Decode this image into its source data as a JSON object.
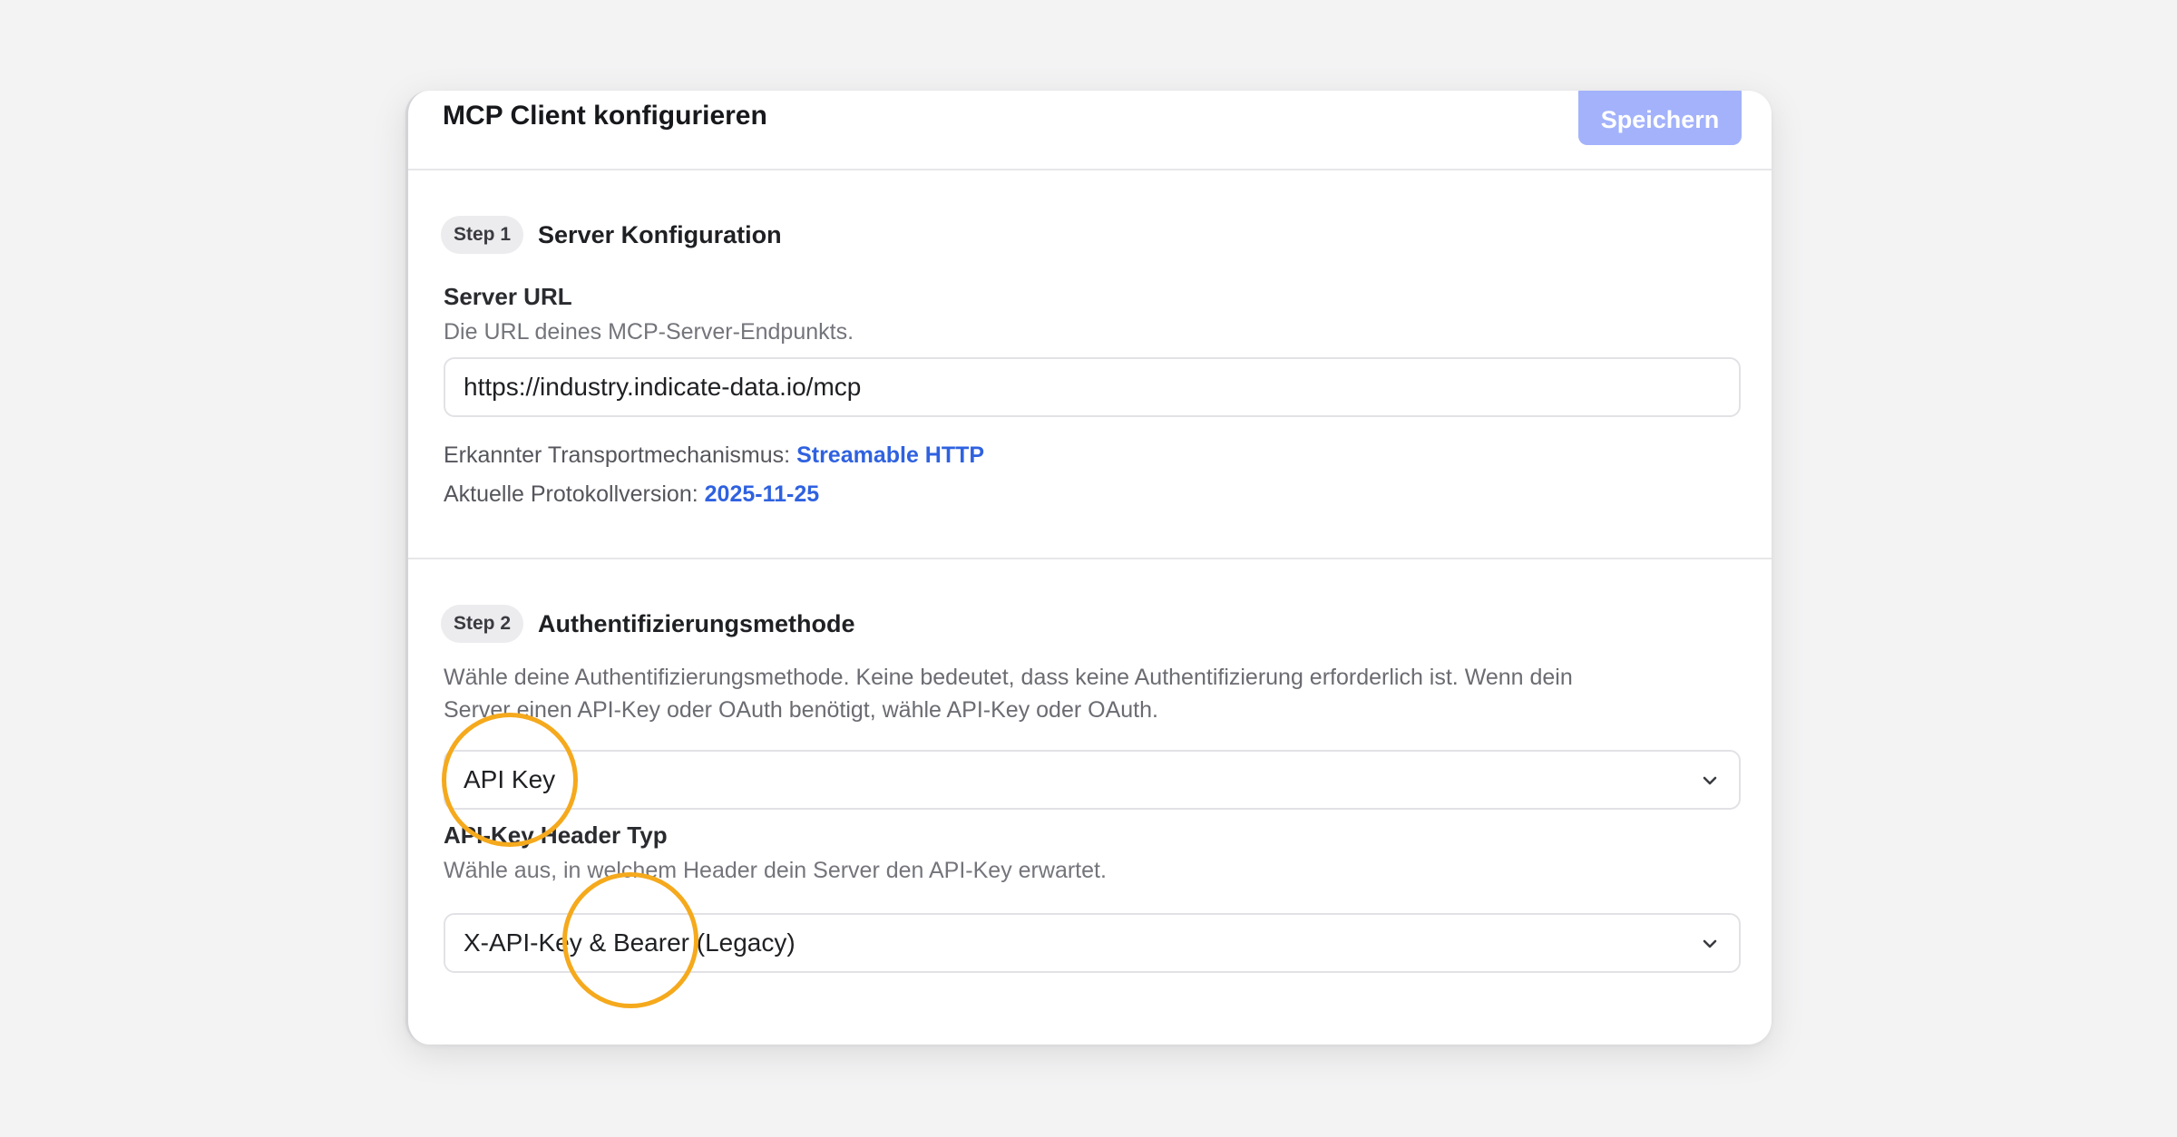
{
  "header": {
    "title": "MCP Client konfigurieren",
    "save_label": "Speichern"
  },
  "step1": {
    "badge": "Step 1",
    "title": "Server Konfiguration",
    "server_url": {
      "label": "Server URL",
      "help": "Die URL deines MCP-Server-Endpunkts.",
      "value": "https://industry.indicate-data.io/mcp"
    },
    "transport": {
      "label": "Erkannter Transportmechanismus:",
      "value": "Streamable HTTP"
    },
    "protocol": {
      "label": "Aktuelle Protokollversion:",
      "value": "2025-11-25"
    }
  },
  "step2": {
    "badge": "Step 2",
    "title": "Authentifizierungsmethode",
    "description_line1": "Wähle deine Authentifizierungsmethode. Keine bedeutet, dass keine Authentifizierung erforderlich ist. Wenn dein",
    "description_line2": "Server einen API-Key oder OAuth benötigt, wähle API-Key oder OAuth.",
    "auth_select": {
      "value": "API Key"
    },
    "header_type": {
      "label": "API-Key Header Typ",
      "help": "Wähle aus, in welchem Header dein Server den API-Key erwartet.",
      "value": "X-API-Key & Bearer (Legacy)"
    }
  },
  "colors": {
    "accent_button": "#a3b2fb",
    "link_value": "#2f62e0",
    "highlight_ring": "#f5a91c"
  }
}
